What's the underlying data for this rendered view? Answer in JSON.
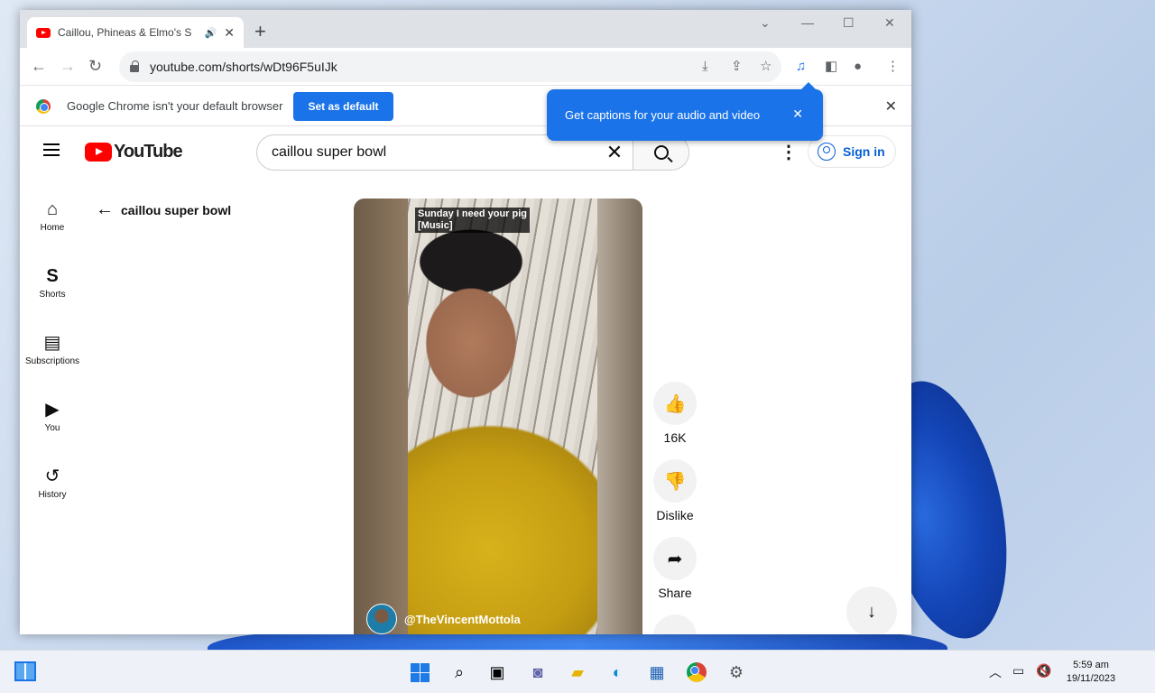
{
  "browser": {
    "tab_title": "Caillou, Phineas & Elmo's S",
    "tab_sound_icon": "speaker-icon",
    "tab_close": "✕",
    "new_tab": "+",
    "url": "youtube.com/shorts/wDt96F5uIJk",
    "infobar_text": "Google Chrome isn't your default browser",
    "infobar_button": "Set as default",
    "infobar_close": "✕",
    "caption_prompt": "Get captions for your audio and video",
    "caption_close": "✕"
  },
  "youtube": {
    "logo_text": "YouTube",
    "search_query": "caillou super bowl",
    "signin_label": "Sign in",
    "guide": [
      {
        "label": "Home",
        "icon": "⌂"
      },
      {
        "label": "Shorts",
        "icon": "S"
      },
      {
        "label": "Subscriptions",
        "icon": "▤"
      },
      {
        "label": "You",
        "icon": "▶"
      },
      {
        "label": "History",
        "icon": "↺"
      }
    ],
    "back_title": "caillou super bowl",
    "short": {
      "caption_line1": "Sunday I need your pig",
      "caption_line2": "[Music]",
      "channel": "@TheVincentMottola"
    },
    "actions": {
      "like_count": "16K",
      "dislike_label": "Dislike",
      "share_label": "Share"
    }
  },
  "taskbar": {
    "time": "5:59 am",
    "date": "19/11/2023"
  },
  "colors": {
    "yt_red": "#ff0000",
    "chrome_blue": "#1a73e8",
    "signin_blue": "#065fd4"
  }
}
